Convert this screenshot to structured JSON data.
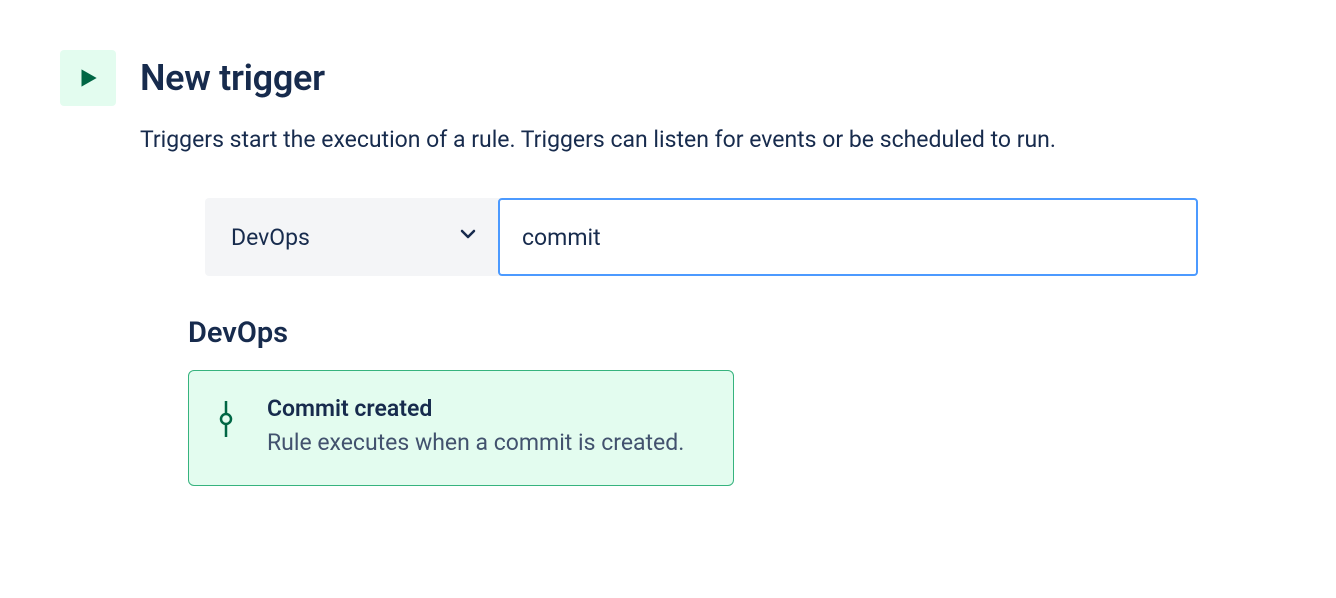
{
  "header": {
    "title": "New trigger",
    "description": "Triggers start the execution of a rule. Triggers can listen for events or be scheduled to run."
  },
  "filter": {
    "dropdown_label": "DevOps",
    "search_value": "commit"
  },
  "section": {
    "title": "DevOps"
  },
  "triggers": [
    {
      "title": "Commit created",
      "description": "Rule executes when a commit is created."
    }
  ]
}
